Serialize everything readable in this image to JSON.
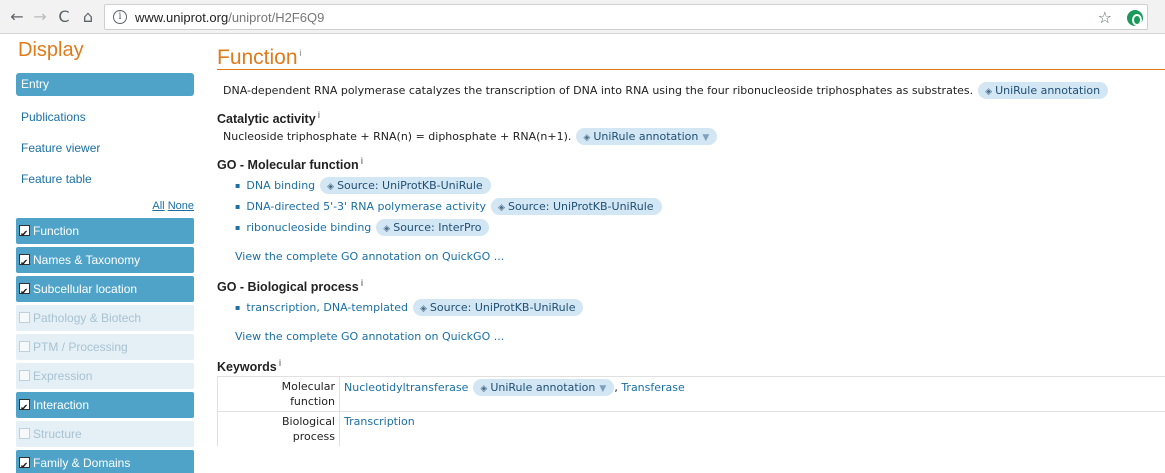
{
  "browser": {
    "url_host": "www.uniprot.org",
    "url_path": "/uniprot/H2F6Q9"
  },
  "sidebar": {
    "title": "Display",
    "entry": "Entry",
    "links": [
      "Publications",
      "Feature viewer",
      "Feature table"
    ],
    "all_label": "All",
    "none_label": "None",
    "sections": [
      {
        "label": "Function",
        "checked": true
      },
      {
        "label": "Names & Taxonomy",
        "checked": true
      },
      {
        "label": "Subcellular location",
        "checked": true
      },
      {
        "label": "Pathology & Biotech",
        "checked": false
      },
      {
        "label": "PTM / Processing",
        "checked": false
      },
      {
        "label": "Expression",
        "checked": false
      },
      {
        "label": "Interaction",
        "checked": true
      },
      {
        "label": "Structure",
        "checked": false
      },
      {
        "label": "Family & Domains",
        "checked": true
      }
    ]
  },
  "main": {
    "title": "Function",
    "info_mark": "i",
    "description": "DNA-dependent RNA polymerase catalyzes the transcription of DNA into RNA using the four ribonucleoside triphosphates as substrates.",
    "description_pill": "UniRule annotation",
    "catalytic": {
      "heading": "Catalytic activity",
      "text": "Nucleoside triphosphate + RNA(n) = diphosphate + RNA(n+1).",
      "pill": "UniRule annotation"
    },
    "go_molecular": {
      "heading": "GO - Molecular function",
      "items": [
        {
          "term": "DNA binding",
          "source": "Source: UniProtKB-UniRule"
        },
        {
          "term": "DNA-directed 5'-3' RNA polymerase activity",
          "source": "Source: UniProtKB-UniRule"
        },
        {
          "term": "ribonucleoside binding",
          "source": "Source: InterPro"
        }
      ],
      "view_link": "View the complete GO annotation on QuickGO ..."
    },
    "go_biological": {
      "heading": "GO - Biological process",
      "items": [
        {
          "term": "transcription, DNA-templated",
          "source": "Source: UniProtKB-UniRule"
        }
      ],
      "view_link": "View the complete GO annotation on QuickGO ..."
    },
    "keywords": {
      "heading": "Keywords",
      "rows": [
        {
          "key_line1": "Molecular",
          "key_line2": "function",
          "value1": "Nucleotidyltransferase",
          "pill": "UniRule annotation",
          "sep": ", ",
          "value2": "Transferase"
        },
        {
          "key_line1": "Biological",
          "key_line2": "process",
          "value1": "Transcription"
        }
      ]
    }
  },
  "colors": {
    "accent_orange": "#e07b1c",
    "sidebar_blue": "#4fa3c9",
    "link_blue": "#1a6fa5",
    "pill_bg": "#d3e6f3"
  }
}
